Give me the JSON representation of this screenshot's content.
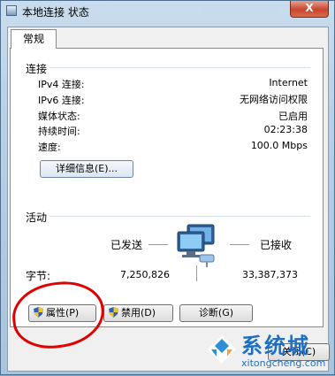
{
  "window": {
    "title": "本地连接 状态",
    "close_label": "X"
  },
  "tabs": [
    {
      "label": "常规"
    }
  ],
  "connection": {
    "group_label": "连接",
    "rows": [
      {
        "label": "IPv4 连接:",
        "value": "Internet"
      },
      {
        "label": "IPv6 连接:",
        "value": "无网络访问权限"
      },
      {
        "label": "媒体状态:",
        "value": "已启用"
      },
      {
        "label": "持续时间:",
        "value": "02:23:38"
      },
      {
        "label": "速度:",
        "value": "100.0 Mbps"
      }
    ],
    "details_button": "详细信息(E)..."
  },
  "activity": {
    "group_label": "活动",
    "sent_label": "已发送",
    "received_label": "已接收",
    "bytes_label": "字节:",
    "bytes_sent": "7,250,826",
    "bytes_received": "33,387,373"
  },
  "buttons": {
    "properties": "属性(P)",
    "disable": "禁用(D)",
    "diagnose": "诊断(G)",
    "close": "关闭(C)"
  },
  "watermark": {
    "text": "系统城",
    "url": "xitongcheng.com"
  },
  "colors": {
    "annotation_circle": "#e00000",
    "watermark": "#1e6fc0"
  }
}
